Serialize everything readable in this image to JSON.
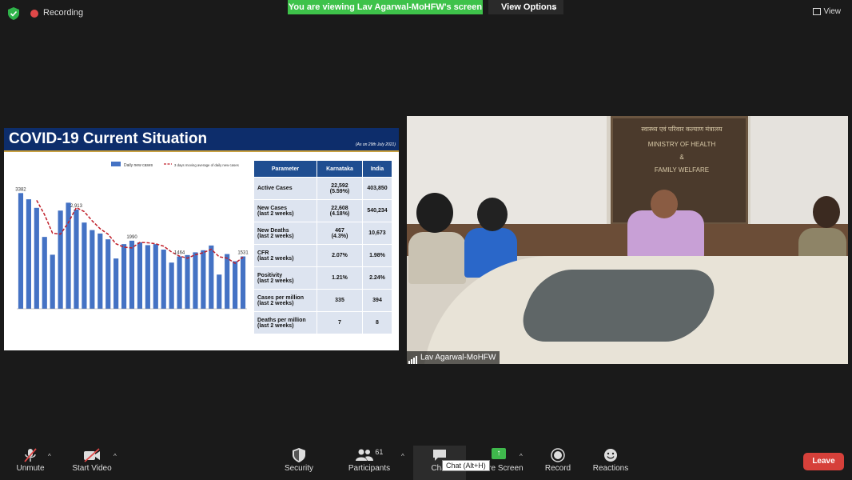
{
  "header": {
    "recording_label": "Recording",
    "viewing_banner": "You are viewing Lav Agarwal-MoHFW's screen",
    "view_options_label": "View Options",
    "view_label": "View"
  },
  "slide": {
    "title": "COVID-19 Current Situation",
    "as_of": "(As on 29th July 2021)",
    "table": {
      "headers": [
        "Parameter",
        "Karnataka",
        "India"
      ],
      "rows": [
        {
          "param1": "Active Cases",
          "param2": "",
          "k1": "22,592",
          "k2": "(5.59%)",
          "india": "403,850"
        },
        {
          "param1": "New Cases",
          "param2": "(last 2 weeks)",
          "k1": "22,608",
          "k2": "(4.18%)",
          "india": "540,234"
        },
        {
          "param1": "New Deaths",
          "param2": "(last 2 weeks)",
          "k1": "467",
          "k2": "(4.3%)",
          "india": "10,673"
        },
        {
          "param1": "CFR",
          "param2": "(last 2 weeks)",
          "k1": "2.07%",
          "k2": "",
          "india": "1.98%"
        },
        {
          "param1": "Positivity",
          "param2": "(last 2 weeks)",
          "k1": "1.21%",
          "k2": "",
          "india": "2.24%"
        },
        {
          "param1": "Cases per million",
          "param2": "(last 2 weeks)",
          "k1": "335",
          "k2": "",
          "india": "394"
        },
        {
          "param1": "Deaths per million",
          "param2": "(last 2 weeks)",
          "k1": "7",
          "k2": "",
          "india": "8"
        }
      ]
    }
  },
  "chart_data": {
    "type": "bar",
    "series": [
      {
        "name": "Daily new cases",
        "values": [
          3382,
          3200,
          2950,
          2100,
          1580,
          2870,
          3100,
          2900,
          2520,
          2300,
          2200,
          2030,
          1470,
          1890,
          1990,
          1940,
          1860,
          1890,
          1730,
          1350,
          1530,
          1570,
          1650,
          1710,
          1850,
          1000,
          1600,
          1390,
          1531
        ]
      },
      {
        "name": "3 days moving average of daily new cases",
        "type": "line",
        "values": [
          null,
          null,
          3170,
          2750,
          2210,
          2180,
          2520,
          2960,
          2840,
          2570,
          2340,
          2180,
          1900,
          1800,
          1780,
          1940,
          1930,
          1900,
          1830,
          1660,
          1540,
          1480,
          1580,
          1640,
          1740,
          1520,
          1480,
          1330,
          1507
        ]
      }
    ],
    "data_labels": [
      {
        "index": 0,
        "text": "3382"
      },
      {
        "index": 7,
        "text": "2,913"
      },
      {
        "index": 14,
        "text": "1990"
      },
      {
        "index": 20,
        "text": "1464"
      },
      {
        "index": 28,
        "text": "1531"
      }
    ],
    "ylim": [
      0,
      3600
    ],
    "legend_position": "top",
    "colors": {
      "bars": "#4472c4",
      "line": "#c0202a"
    }
  },
  "camera": {
    "board_lines": [
      "स्वास्थ्य एवं परिवार कल्याण मंत्रालय",
      "MINISTRY OF HEALTH",
      "&",
      "FAMILY WELFARE"
    ],
    "participant_name": "Lav Agarwal-MoHFW"
  },
  "toolbar": {
    "unmute": "Unmute",
    "start_video": "Start Video",
    "security": "Security",
    "participants": "Participants",
    "participants_count": "61",
    "chat": "Chat",
    "chat_tooltip": "Chat (Alt+H)",
    "share_screen": "Share Screen",
    "record": "Record",
    "reactions": "Reactions",
    "leave": "Leave"
  }
}
